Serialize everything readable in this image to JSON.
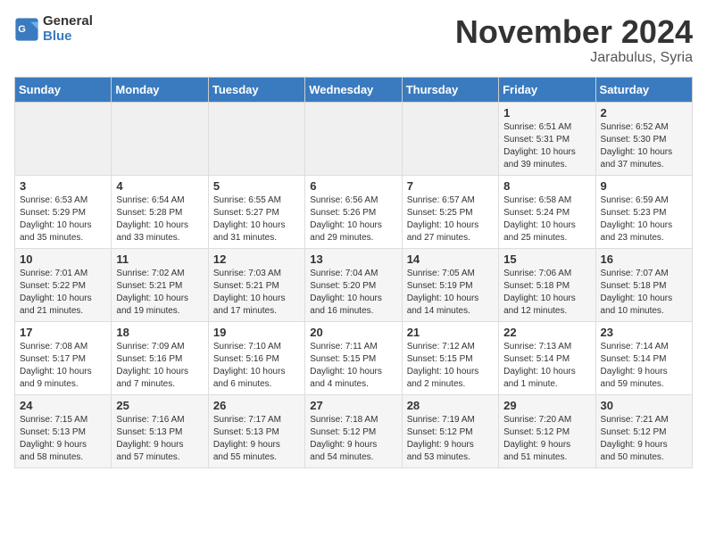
{
  "logo": {
    "general": "General",
    "blue": "Blue"
  },
  "title": "November 2024",
  "subtitle": "Jarabulus, Syria",
  "days_header": [
    "Sunday",
    "Monday",
    "Tuesday",
    "Wednesday",
    "Thursday",
    "Friday",
    "Saturday"
  ],
  "weeks": [
    [
      {
        "day": "",
        "info": ""
      },
      {
        "day": "",
        "info": ""
      },
      {
        "day": "",
        "info": ""
      },
      {
        "day": "",
        "info": ""
      },
      {
        "day": "",
        "info": ""
      },
      {
        "day": "1",
        "info": "Sunrise: 6:51 AM\nSunset: 5:31 PM\nDaylight: 10 hours\nand 39 minutes."
      },
      {
        "day": "2",
        "info": "Sunrise: 6:52 AM\nSunset: 5:30 PM\nDaylight: 10 hours\nand 37 minutes."
      }
    ],
    [
      {
        "day": "3",
        "info": "Sunrise: 6:53 AM\nSunset: 5:29 PM\nDaylight: 10 hours\nand 35 minutes."
      },
      {
        "day": "4",
        "info": "Sunrise: 6:54 AM\nSunset: 5:28 PM\nDaylight: 10 hours\nand 33 minutes."
      },
      {
        "day": "5",
        "info": "Sunrise: 6:55 AM\nSunset: 5:27 PM\nDaylight: 10 hours\nand 31 minutes."
      },
      {
        "day": "6",
        "info": "Sunrise: 6:56 AM\nSunset: 5:26 PM\nDaylight: 10 hours\nand 29 minutes."
      },
      {
        "day": "7",
        "info": "Sunrise: 6:57 AM\nSunset: 5:25 PM\nDaylight: 10 hours\nand 27 minutes."
      },
      {
        "day": "8",
        "info": "Sunrise: 6:58 AM\nSunset: 5:24 PM\nDaylight: 10 hours\nand 25 minutes."
      },
      {
        "day": "9",
        "info": "Sunrise: 6:59 AM\nSunset: 5:23 PM\nDaylight: 10 hours\nand 23 minutes."
      }
    ],
    [
      {
        "day": "10",
        "info": "Sunrise: 7:01 AM\nSunset: 5:22 PM\nDaylight: 10 hours\nand 21 minutes."
      },
      {
        "day": "11",
        "info": "Sunrise: 7:02 AM\nSunset: 5:21 PM\nDaylight: 10 hours\nand 19 minutes."
      },
      {
        "day": "12",
        "info": "Sunrise: 7:03 AM\nSunset: 5:21 PM\nDaylight: 10 hours\nand 17 minutes."
      },
      {
        "day": "13",
        "info": "Sunrise: 7:04 AM\nSunset: 5:20 PM\nDaylight: 10 hours\nand 16 minutes."
      },
      {
        "day": "14",
        "info": "Sunrise: 7:05 AM\nSunset: 5:19 PM\nDaylight: 10 hours\nand 14 minutes."
      },
      {
        "day": "15",
        "info": "Sunrise: 7:06 AM\nSunset: 5:18 PM\nDaylight: 10 hours\nand 12 minutes."
      },
      {
        "day": "16",
        "info": "Sunrise: 7:07 AM\nSunset: 5:18 PM\nDaylight: 10 hours\nand 10 minutes."
      }
    ],
    [
      {
        "day": "17",
        "info": "Sunrise: 7:08 AM\nSunset: 5:17 PM\nDaylight: 10 hours\nand 9 minutes."
      },
      {
        "day": "18",
        "info": "Sunrise: 7:09 AM\nSunset: 5:16 PM\nDaylight: 10 hours\nand 7 minutes."
      },
      {
        "day": "19",
        "info": "Sunrise: 7:10 AM\nSunset: 5:16 PM\nDaylight: 10 hours\nand 6 minutes."
      },
      {
        "day": "20",
        "info": "Sunrise: 7:11 AM\nSunset: 5:15 PM\nDaylight: 10 hours\nand 4 minutes."
      },
      {
        "day": "21",
        "info": "Sunrise: 7:12 AM\nSunset: 5:15 PM\nDaylight: 10 hours\nand 2 minutes."
      },
      {
        "day": "22",
        "info": "Sunrise: 7:13 AM\nSunset: 5:14 PM\nDaylight: 10 hours\nand 1 minute."
      },
      {
        "day": "23",
        "info": "Sunrise: 7:14 AM\nSunset: 5:14 PM\nDaylight: 9 hours\nand 59 minutes."
      }
    ],
    [
      {
        "day": "24",
        "info": "Sunrise: 7:15 AM\nSunset: 5:13 PM\nDaylight: 9 hours\nand 58 minutes."
      },
      {
        "day": "25",
        "info": "Sunrise: 7:16 AM\nSunset: 5:13 PM\nDaylight: 9 hours\nand 57 minutes."
      },
      {
        "day": "26",
        "info": "Sunrise: 7:17 AM\nSunset: 5:13 PM\nDaylight: 9 hours\nand 55 minutes."
      },
      {
        "day": "27",
        "info": "Sunrise: 7:18 AM\nSunset: 5:12 PM\nDaylight: 9 hours\nand 54 minutes."
      },
      {
        "day": "28",
        "info": "Sunrise: 7:19 AM\nSunset: 5:12 PM\nDaylight: 9 hours\nand 53 minutes."
      },
      {
        "day": "29",
        "info": "Sunrise: 7:20 AM\nSunset: 5:12 PM\nDaylight: 9 hours\nand 51 minutes."
      },
      {
        "day": "30",
        "info": "Sunrise: 7:21 AM\nSunset: 5:12 PM\nDaylight: 9 hours\nand 50 minutes."
      }
    ]
  ]
}
